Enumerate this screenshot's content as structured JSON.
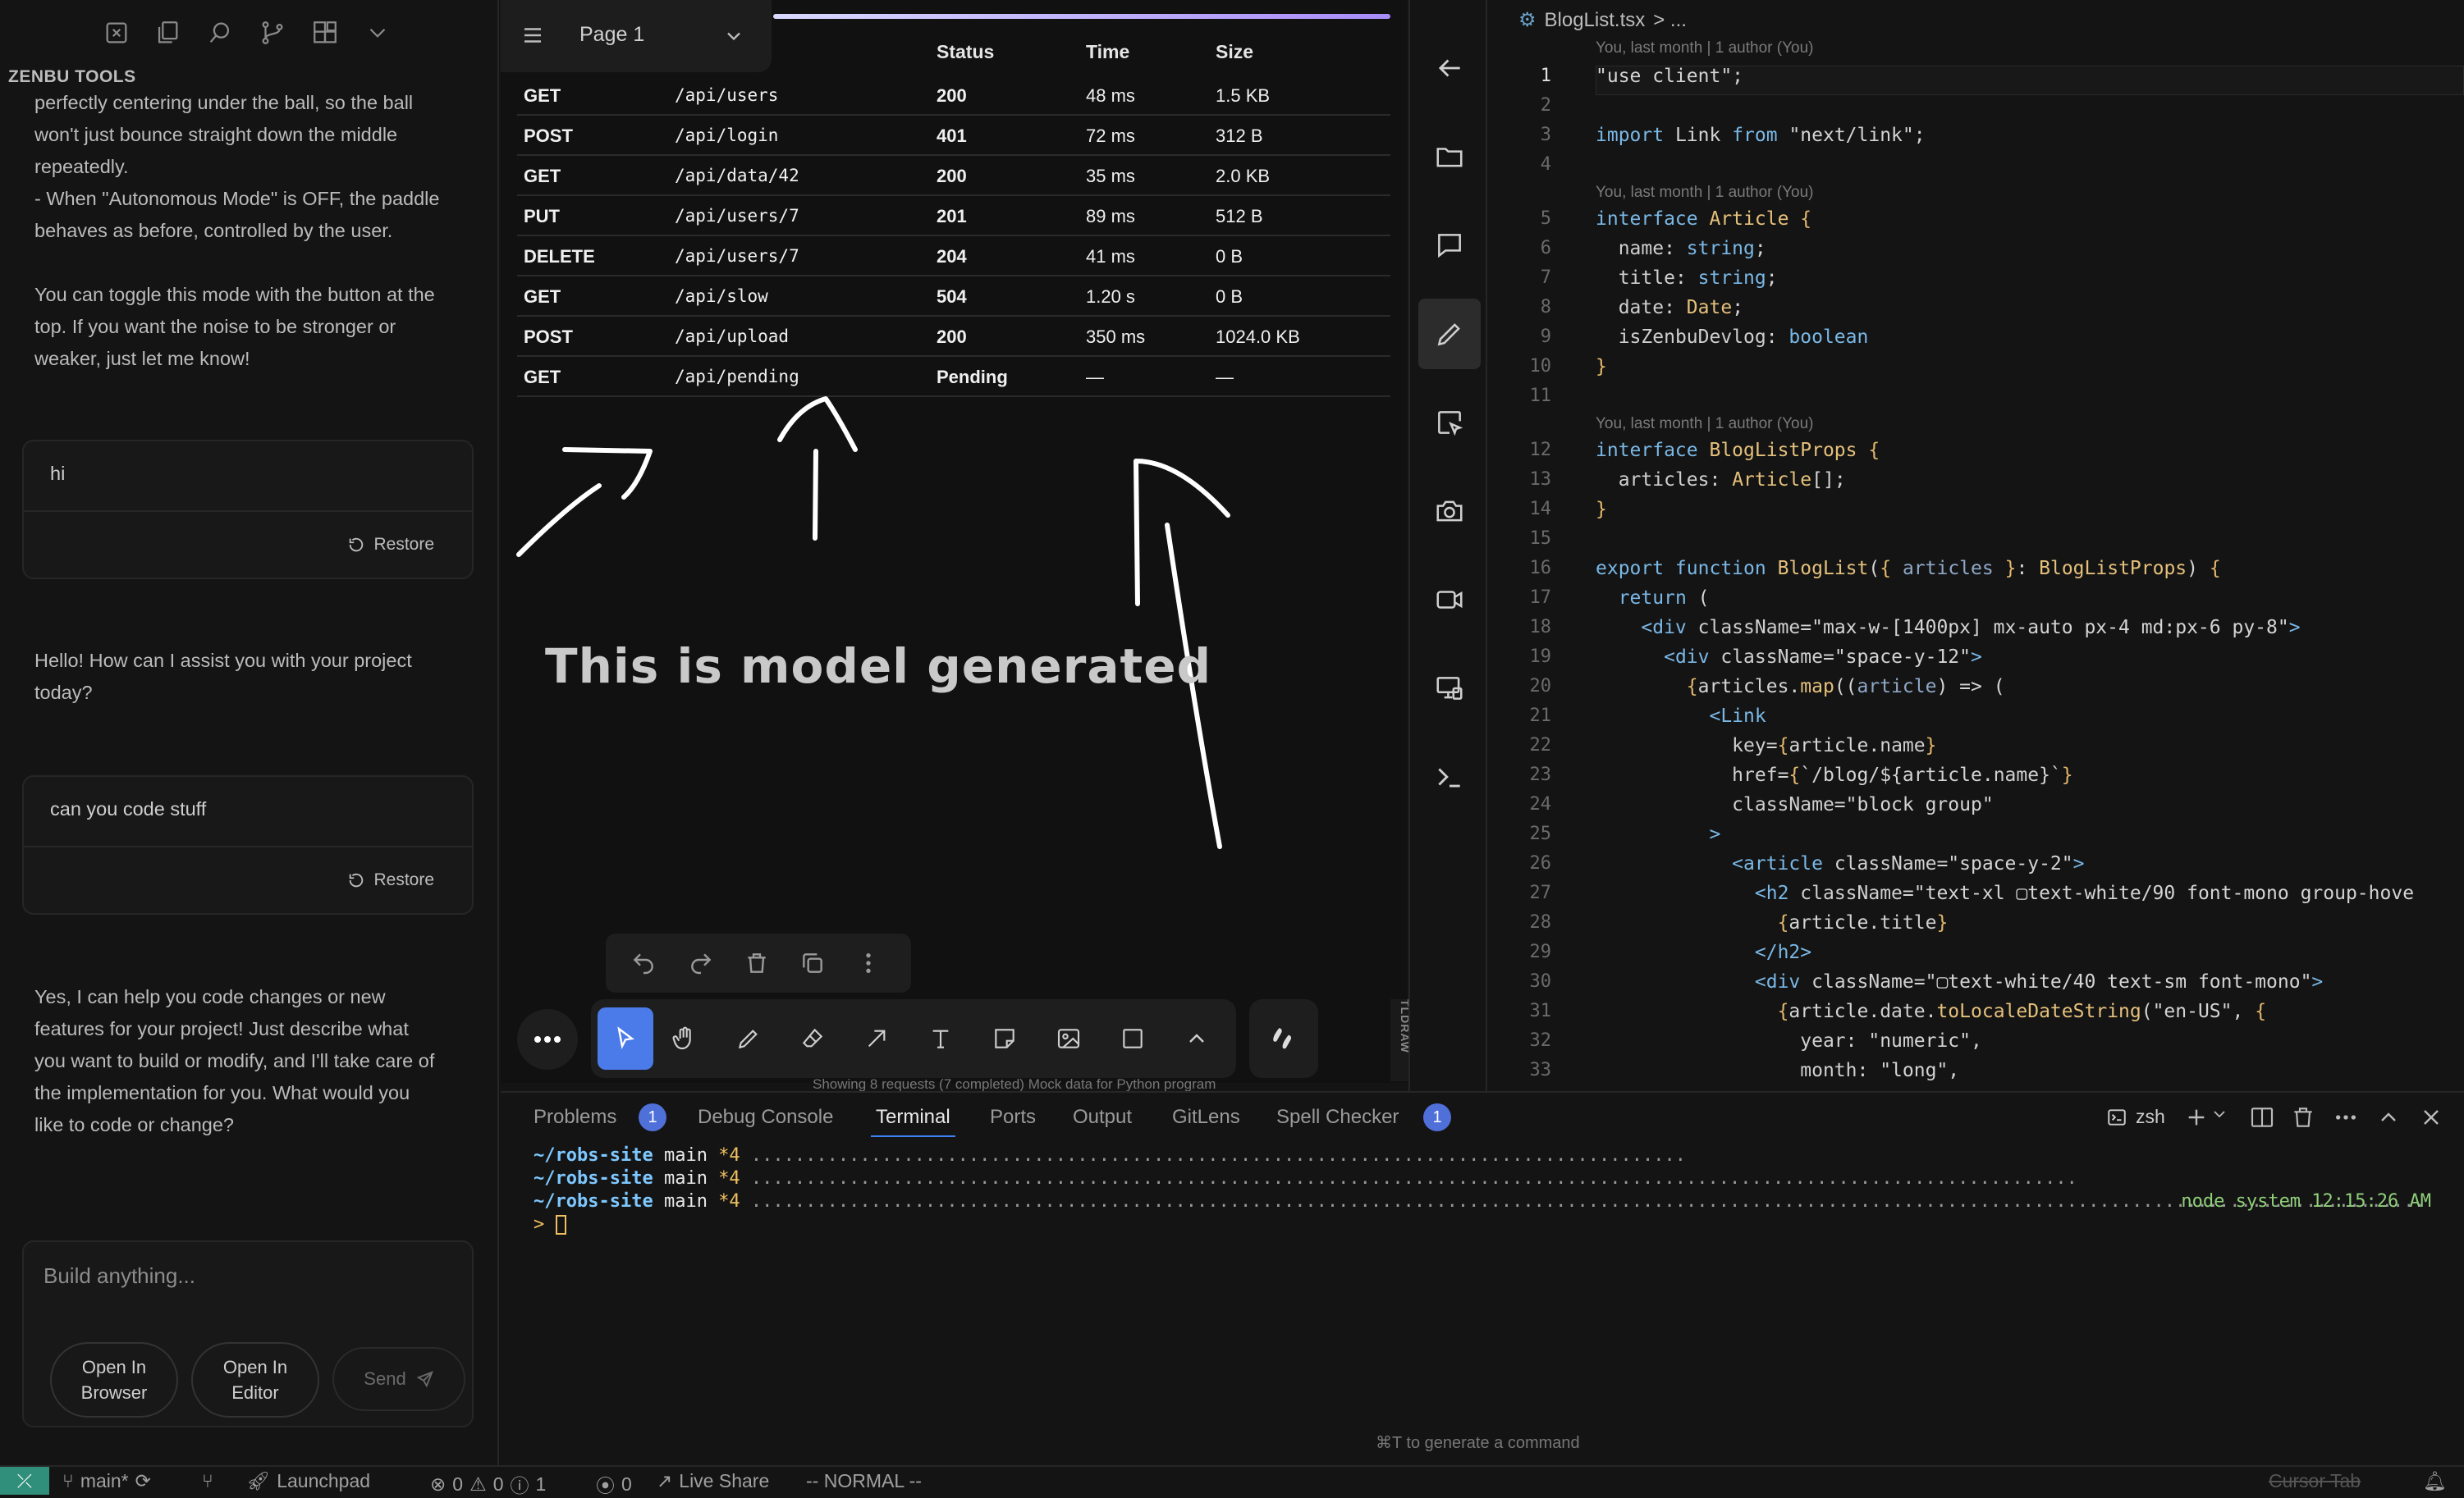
{
  "left": {
    "brand": "ZENBU TOOLS",
    "chat_top": [
      "perfectly centering under the ball, so the ball",
      "won't just bounce straight down the middle",
      "repeatedly.",
      "- When \"Autonomous Mode\" is OFF, the paddle",
      "behaves as before, controlled by the user.",
      "",
      "You can toggle this mode with the button at the",
      "top. If you want the noise to be stronger or",
      "weaker, just let me know!"
    ],
    "user_msg_1": "hi",
    "restore_label": "Restore",
    "assistant_1": [
      "Hello! How can I assist you with your project",
      "today?"
    ],
    "user_msg_2": "can you code stuff",
    "assistant_2": [
      "Yes, I can help you code changes or new",
      "features for your project! Just describe what",
      "you want to build or modify, and I'll take care of",
      "the implementation for you. What would you",
      "like to code or change?"
    ],
    "composer_placeholder": "Build anything...",
    "open_browser": [
      "Open In",
      "Browser"
    ],
    "open_editor": [
      "Open In",
      "Editor"
    ],
    "send": "Send"
  },
  "canvas": {
    "page_label": "Page 1",
    "headers": {
      "status": "Status",
      "time": "Time",
      "size": "Size"
    },
    "rows": [
      {
        "method": "GET",
        "path": "/api/users",
        "status": "200",
        "time": "48 ms",
        "size": "1.5 KB"
      },
      {
        "method": "POST",
        "path": "/api/login",
        "status": "401",
        "time": "72 ms",
        "size": "312 B"
      },
      {
        "method": "GET",
        "path": "/api/data/42",
        "status": "200",
        "time": "35 ms",
        "size": "2.0 KB"
      },
      {
        "method": "PUT",
        "path": "/api/users/7",
        "status": "201",
        "time": "89 ms",
        "size": "512 B"
      },
      {
        "method": "DELETE",
        "path": "/api/users/7",
        "status": "204",
        "time": "41 ms",
        "size": "0 B"
      },
      {
        "method": "GET",
        "path": "/api/slow",
        "status": "504",
        "time": "1.20 s",
        "size": "0 B"
      },
      {
        "method": "POST",
        "path": "/api/upload",
        "status": "200",
        "time": "350 ms",
        "size": "1024.0 KB"
      },
      {
        "method": "GET",
        "path": "/api/pending",
        "status": "Pending",
        "time": "—",
        "size": "—"
      }
    ],
    "handwriting": "This is model generated",
    "footer_note": "Showing 8 requests (7 completed)     Mock data for Python program",
    "tldraw_tag": "TLDRAW"
  },
  "editor": {
    "filename": "BlogList.tsx",
    "breadcrumb_rest": "> ...",
    "blame": "You, last month | 1 author (You)"
  },
  "panel": {
    "tabs": [
      "Problems",
      "Debug Console",
      "Terminal",
      "Ports",
      "Output",
      "GitLens",
      "Spell Checker"
    ],
    "problems_count": "1",
    "spell_count": "1",
    "shell": "zsh",
    "prompt_path": "~/robs-site",
    "prompt_branch": "main",
    "prompt_status": "*4",
    "right_info": "node system 12:15:26 AM",
    "prompt_symbol": ">",
    "generate_hint": "⌘T to generate a command"
  },
  "status": {
    "branch": "main*",
    "launchpad": "Launchpad",
    "problems": "0",
    "warnings": "0",
    "infos": "1",
    "ports": "0",
    "live_share": "Live Share",
    "mode": "-- NORMAL --",
    "cursor_tab": "Cursor Tab"
  }
}
